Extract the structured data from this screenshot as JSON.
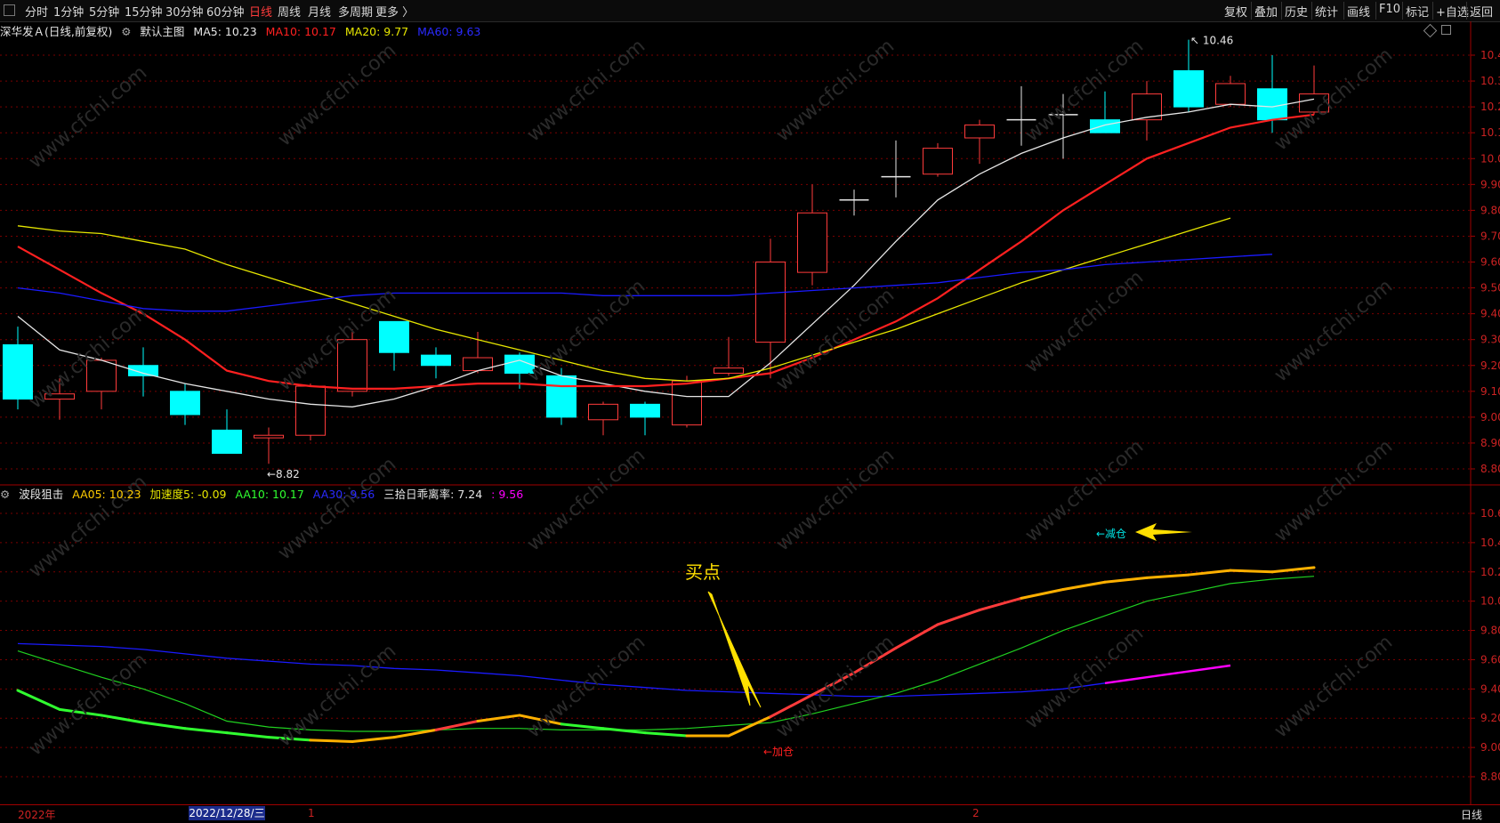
{
  "toolbar": {
    "periods": [
      "分时",
      "1分钟",
      "5分钟",
      "15分钟",
      "30分钟",
      "60分钟",
      "日线",
      "周线",
      "月线",
      "多周期",
      "更多 〉"
    ],
    "active": "日线",
    "right": [
      "复权",
      "叠加",
      "历史",
      "统计",
      "画线",
      "F10",
      "标记",
      "+自选",
      "返回"
    ]
  },
  "main_header": {
    "stock": "深华发Ａ(日线,前复权)",
    "chart_name": "默认主图",
    "ma5": "MA5: 10.23",
    "ma10": "MA10: 10.17",
    "ma20": "MA20: 9.77",
    "ma60": "MA60: 9.63"
  },
  "ind_header": {
    "name": "波段狙击",
    "aa05": "AA05: 10.23",
    "accel": "加速度5: -0.09",
    "aa10": "AA10: 10.17",
    "aa30": "AA30: 9.56",
    "bias": "三拾日乖离率: 7.24",
    "bias2": ": 9.56"
  },
  "annotations": {
    "high": "10.46",
    "low": "8.82",
    "buy_point": "买点",
    "reduce": "←减仓",
    "add": "←加仓"
  },
  "watermark": "www.cfchi.com",
  "bottom": {
    "year": "2022年",
    "cursor_date": "2022/12/28/三",
    "month1": "1",
    "month2": "2",
    "period": "日线"
  },
  "colors": {
    "up": "#ff3b3b",
    "down": "#00ffff",
    "ma5": "#e6e6e6",
    "ma10": "#ff2020",
    "ma20": "#e6e600",
    "ma60": "#1a1aff",
    "accent_yellow": "#ffe000",
    "magenta": "#ff00ff",
    "green": "#30ff30"
  },
  "chart_data": [
    {
      "type": "candlestick",
      "ylim": [
        8.75,
        10.55
      ],
      "y_ticks": [
        10.4,
        10.3,
        10.2,
        10.1,
        10.0,
        9.9,
        9.8,
        9.7,
        9.6,
        9.5,
        9.4,
        9.3,
        9.2,
        9.1,
        9.0,
        8.9,
        8.8
      ],
      "candles": [
        {
          "o": 9.28,
          "h": 9.35,
          "l": 9.03,
          "c": 9.07
        },
        {
          "o": 9.07,
          "h": 9.15,
          "l": 8.99,
          "c": 9.09
        },
        {
          "o": 9.1,
          "h": 9.23,
          "l": 9.03,
          "c": 9.22
        },
        {
          "o": 9.2,
          "h": 9.27,
          "l": 9.08,
          "c": 9.16
        },
        {
          "o": 9.1,
          "h": 9.13,
          "l": 8.97,
          "c": 9.01
        },
        {
          "o": 8.95,
          "h": 9.03,
          "l": 8.86,
          "c": 8.86
        },
        {
          "o": 8.92,
          "h": 8.96,
          "l": 8.82,
          "c": 8.93
        },
        {
          "o": 8.93,
          "h": 9.13,
          "l": 8.91,
          "c": 9.12
        },
        {
          "o": 9.1,
          "h": 9.34,
          "l": 9.08,
          "c": 9.3
        },
        {
          "o": 9.37,
          "h": 9.37,
          "l": 9.18,
          "c": 9.25
        },
        {
          "o": 9.24,
          "h": 9.27,
          "l": 9.15,
          "c": 9.2
        },
        {
          "o": 9.18,
          "h": 9.33,
          "l": 9.17,
          "c": 9.23
        },
        {
          "o": 9.24,
          "h": 9.25,
          "l": 9.11,
          "c": 9.17
        },
        {
          "o": 9.16,
          "h": 9.19,
          "l": 8.97,
          "c": 9.0
        },
        {
          "o": 8.99,
          "h": 9.06,
          "l": 8.93,
          "c": 9.05
        },
        {
          "o": 9.05,
          "h": 9.06,
          "l": 8.93,
          "c": 9.0
        },
        {
          "o": 8.97,
          "h": 9.16,
          "l": 8.96,
          "c": 9.14
        },
        {
          "o": 9.17,
          "h": 9.31,
          "l": 9.16,
          "c": 9.19
        },
        {
          "o": 9.29,
          "h": 9.69,
          "l": 9.15,
          "c": 9.6
        },
        {
          "o": 9.56,
          "h": 9.9,
          "l": 9.51,
          "c": 9.79
        },
        {
          "o": 9.84,
          "h": 9.88,
          "l": 9.78,
          "c": 9.84
        },
        {
          "o": 9.93,
          "h": 10.07,
          "l": 9.85,
          "c": 9.93
        },
        {
          "o": 9.94,
          "h": 10.06,
          "l": 9.93,
          "c": 10.04
        },
        {
          "o": 10.08,
          "h": 10.15,
          "l": 9.98,
          "c": 10.13
        },
        {
          "o": 10.15,
          "h": 10.28,
          "l": 10.05,
          "c": 10.15
        },
        {
          "o": 10.17,
          "h": 10.25,
          "l": 10.0,
          "c": 10.17
        },
        {
          "o": 10.15,
          "h": 10.26,
          "l": 10.1,
          "c": 10.1
        },
        {
          "o": 10.15,
          "h": 10.3,
          "l": 10.07,
          "c": 10.25
        },
        {
          "o": 10.34,
          "h": 10.46,
          "l": 10.18,
          "c": 10.2
        },
        {
          "o": 10.21,
          "h": 10.32,
          "l": 10.2,
          "c": 10.29
        },
        {
          "o": 10.27,
          "h": 10.4,
          "l": 10.1,
          "c": 10.15
        },
        {
          "o": 10.18,
          "h": 10.36,
          "l": 10.17,
          "c": 10.25
        }
      ],
      "series": [
        {
          "name": "MA5",
          "values": [
            9.39,
            9.26,
            9.22,
            9.17,
            9.13,
            9.1,
            9.07,
            9.05,
            9.04,
            9.07,
            9.12,
            9.18,
            9.22,
            9.16,
            9.13,
            9.1,
            9.08,
            9.08,
            9.21,
            9.36,
            9.51,
            9.68,
            9.84,
            9.94,
            10.02,
            10.08,
            10.13,
            10.16,
            10.18,
            10.21,
            10.2,
            10.23
          ]
        },
        {
          "name": "MA10",
          "values": [
            9.66,
            9.57,
            9.48,
            9.4,
            9.3,
            9.18,
            9.14,
            9.12,
            9.11,
            9.11,
            9.12,
            9.13,
            9.13,
            9.12,
            9.12,
            9.12,
            9.13,
            9.15,
            9.17,
            9.23,
            9.3,
            9.37,
            9.46,
            9.57,
            9.68,
            9.8,
            9.9,
            10.0,
            10.06,
            10.12,
            10.15,
            10.17
          ]
        },
        {
          "name": "MA20",
          "values": [
            9.74,
            9.72,
            9.71,
            9.68,
            9.65,
            9.59,
            9.54,
            9.49,
            9.44,
            9.39,
            9.34,
            9.3,
            9.26,
            9.22,
            9.18,
            9.15,
            9.14,
            9.15,
            9.19,
            9.24,
            9.29,
            9.34,
            9.4,
            9.46,
            9.52,
            9.57,
            9.62,
            9.67,
            9.72,
            9.77
          ]
        },
        {
          "name": "MA60",
          "values": [
            9.5,
            9.48,
            9.45,
            9.42,
            9.41,
            9.41,
            9.43,
            9.45,
            9.47,
            9.48,
            9.48,
            9.48,
            9.48,
            9.48,
            9.47,
            9.47,
            9.47,
            9.47,
            9.48,
            9.49,
            9.5,
            9.51,
            9.52,
            9.54,
            9.56,
            9.57,
            9.59,
            9.6,
            9.61,
            9.62,
            9.63
          ]
        }
      ]
    },
    {
      "type": "line",
      "ylim": [
        8.75,
        10.75
      ],
      "y_ticks": [
        10.6,
        10.4,
        10.2,
        10.0,
        9.8,
        9.6,
        9.4,
        9.2,
        9.0,
        8.8
      ],
      "series": [
        {
          "name": "AA05",
          "values": [
            9.39,
            9.26,
            9.22,
            9.17,
            9.13,
            9.1,
            9.07,
            9.05,
            9.04,
            9.07,
            9.12,
            9.18,
            9.22,
            9.16,
            9.13,
            9.1,
            9.08,
            9.08,
            9.21,
            9.36,
            9.51,
            9.68,
            9.84,
            9.94,
            10.02,
            10.08,
            10.13,
            10.16,
            10.18,
            10.21,
            10.2,
            10.23
          ]
        },
        {
          "name": "AA10",
          "values": [
            9.66,
            9.57,
            9.48,
            9.4,
            9.3,
            9.18,
            9.14,
            9.12,
            9.11,
            9.11,
            9.12,
            9.13,
            9.13,
            9.12,
            9.12,
            9.12,
            9.13,
            9.15,
            9.17,
            9.23,
            9.3,
            9.37,
            9.46,
            9.57,
            9.68,
            9.8,
            9.9,
            10.0,
            10.06,
            10.12,
            10.15,
            10.17
          ]
        },
        {
          "name": "AA30",
          "values": [
            9.71,
            9.7,
            9.69,
            9.67,
            9.64,
            9.61,
            9.59,
            9.57,
            9.56,
            9.54,
            9.53,
            9.51,
            9.49,
            9.46,
            9.43,
            9.41,
            9.39,
            9.38,
            9.37,
            9.36,
            9.35,
            9.35,
            9.36,
            9.37,
            9.38,
            9.4,
            9.44,
            9.48,
            9.52,
            9.56
          ]
        }
      ]
    }
  ]
}
